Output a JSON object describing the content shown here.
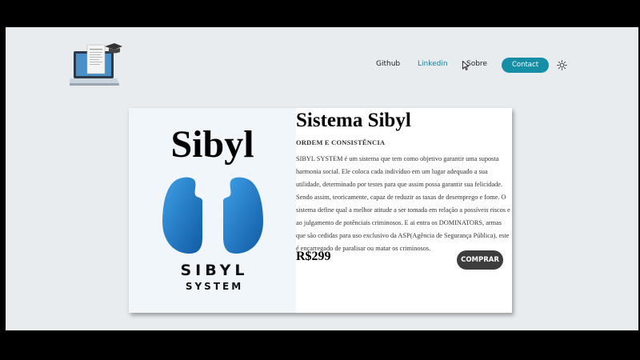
{
  "header": {
    "logo_icon": "laptop-graduation-cap-icon",
    "nav": {
      "github": "Github",
      "linkedin": "Linkedin",
      "sobre": "Sobre",
      "contact": "Contact"
    },
    "theme_icon": "sun-icon"
  },
  "product": {
    "brand_word": "Sibyl",
    "brand_logo_text": [
      "SIBYL",
      "SYSTEM"
    ],
    "title": "Sistema Sibyl",
    "subtitle": "ORDEM E CONSISTÊNCIA",
    "description": "SIBYL SYSTEM é um sistema que tem como objetivo garantir uma suposta harmonia social. Ele coloca cada indivíduo em um lugar adequado a sua utilidade, determinado por testes para que assim possa garantir sua felicidade. Sendo assim, teoricamente, capaz de reduzir as taxas de desemprego e fome. O sistema define qual a melhor atitude a ser tomada em relação a possíveis riscos e ao julgamento de potênciais criminosos. E ai entra os DOMINATORS, armas que são cedidas para uso exclusivo da ASP(Agência de Segurança Pública), este é encarregado de paralisar ou matar os criminosos.",
    "price": "R$299",
    "buy_label": "COMPRAR"
  },
  "colors": {
    "accent": "#158ea6",
    "linkedin": "#1a7d96",
    "buy_button": "#3d3d3d",
    "lungs_blue": "#1c74c4"
  }
}
